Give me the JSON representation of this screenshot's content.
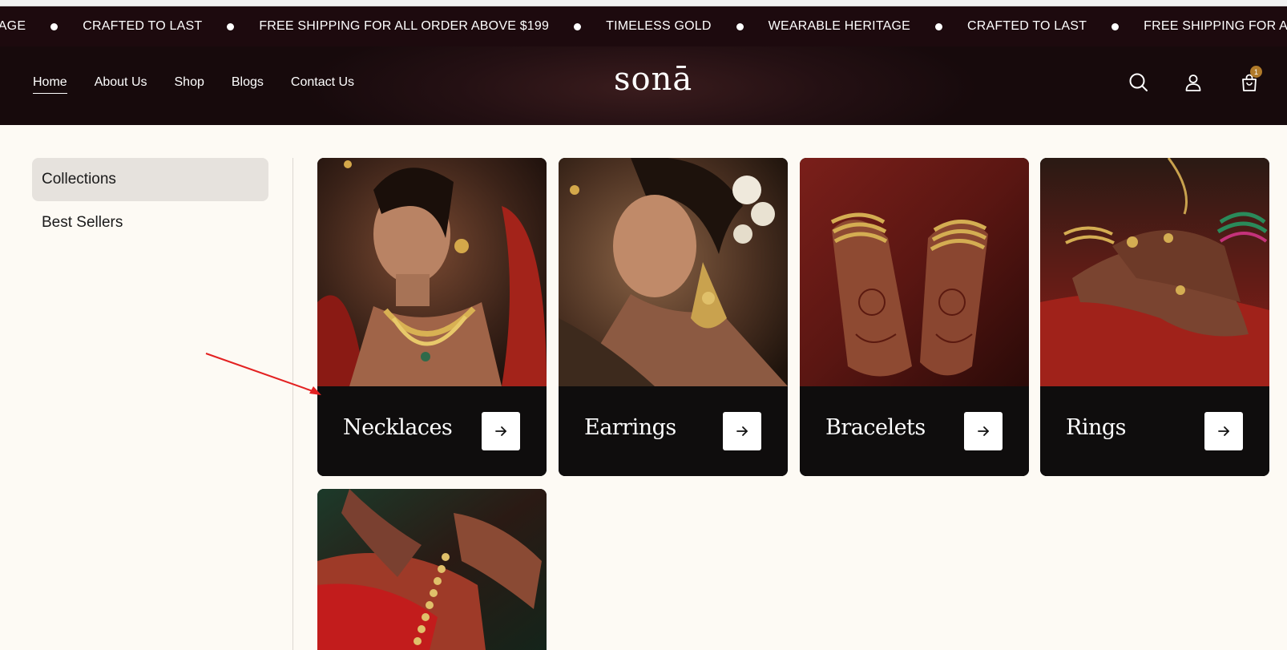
{
  "ticker": {
    "items": [
      "HERITAGE",
      "CRAFTED TO LAST",
      "FREE SHIPPING FOR ALL ORDER ABOVE $199",
      "TIMELESS GOLD",
      "WEARABLE HERITAGE",
      "CRAFTED TO LAST",
      "FREE SHIPPING FOR ALL ORDE"
    ]
  },
  "header": {
    "nav": [
      "Home",
      "About Us",
      "Shop",
      "Blogs",
      "Contact Us"
    ],
    "active_nav": "Home",
    "logo": "sonā",
    "icons": [
      "search-icon",
      "account-icon",
      "cart-icon"
    ],
    "cart_count": "1"
  },
  "sidebar": {
    "items": [
      "Collections",
      "Best Sellers"
    ],
    "active": "Collections"
  },
  "collections": {
    "cards": [
      {
        "title": "Necklaces"
      },
      {
        "title": "Earrings"
      },
      {
        "title": "Bracelets"
      },
      {
        "title": "Rings"
      },
      {
        "title": ""
      }
    ]
  },
  "colors": {
    "ticker_bg": "#1d0a0e",
    "header_bg": "#241013",
    "page_bg": "#fdfaf4",
    "card_bg": "#0f0d0d",
    "annotation": "#e32121"
  }
}
